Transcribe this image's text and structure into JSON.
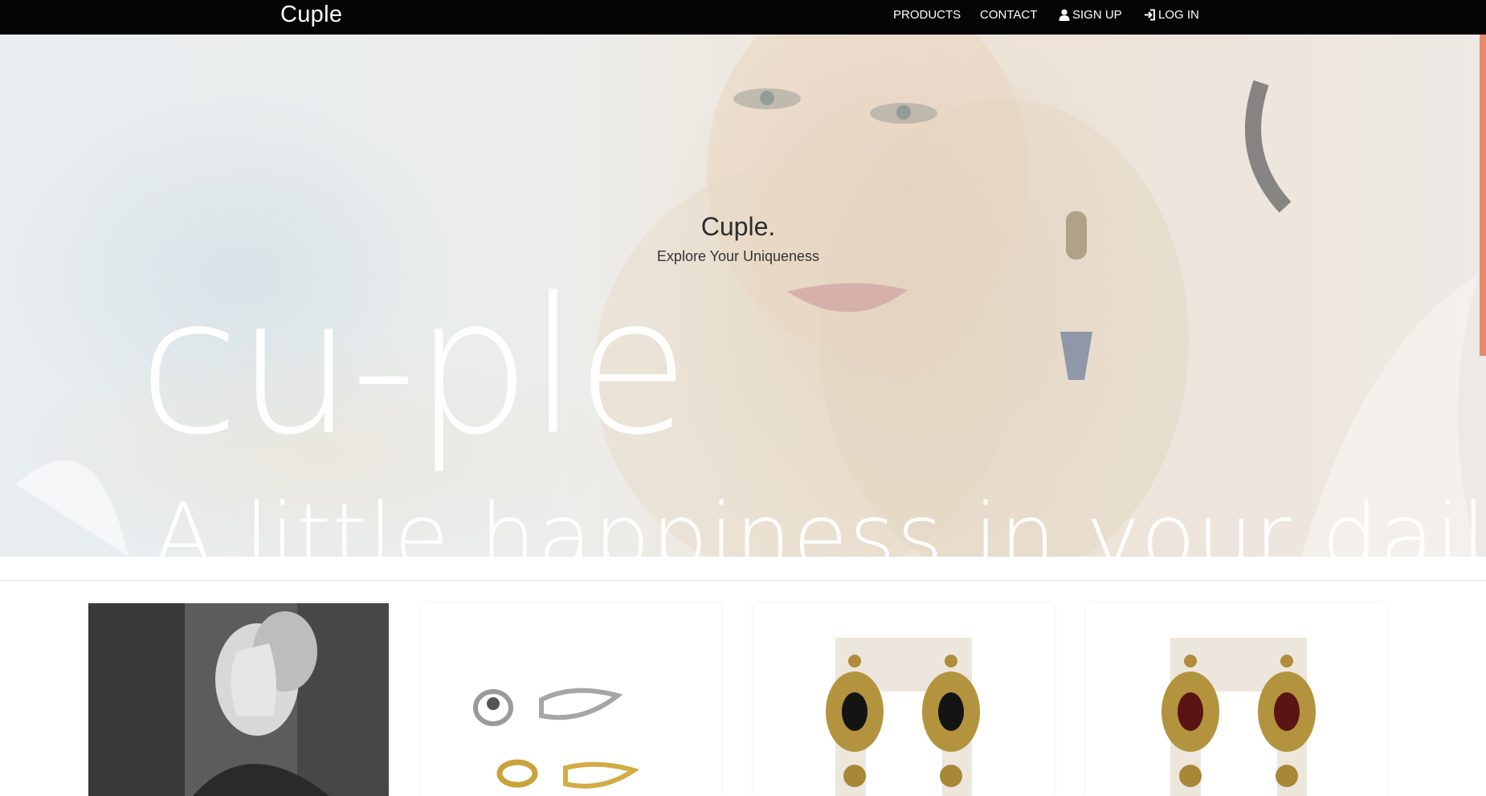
{
  "navbar": {
    "brand": "Cuple",
    "links": {
      "products": "PRODUCTS",
      "contact": "CONTACT",
      "signup": "SIGN UP",
      "login": "LOG IN"
    }
  },
  "hero": {
    "title": "Cuple.",
    "subtitle": "Explore Your Uniqueness",
    "script_text": "cu-ple",
    "tagline": "A little happiness in your daily life"
  },
  "icons": {
    "signup": "user-icon",
    "login": "log-in-icon"
  },
  "colors": {
    "navbar_bg": "#050505",
    "accent": "#e8896a",
    "text_dark": "#2c2c2c"
  }
}
